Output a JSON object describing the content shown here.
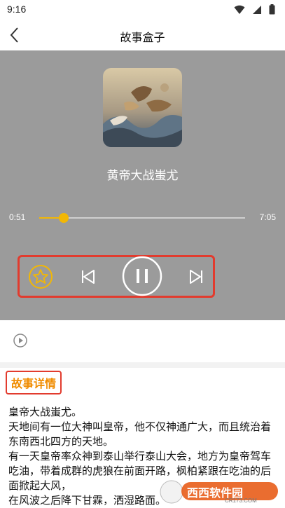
{
  "status": {
    "time": "9:16"
  },
  "header": {
    "title": "故事盒子"
  },
  "player": {
    "song_title": "黄帝大战蚩尤",
    "time_current": "0:51",
    "time_total": "7:05",
    "progress": 0.12
  },
  "detail": {
    "heading": "故事详情",
    "lines": [
      "皇帝大战蚩尤。",
      "天地间有一位大神叫皇帝，他不仅神通广大，而且统治着东南西北四方的天地。",
      "有一天皇帝率众神到泰山举行泰山大会，地方为皇帝驾车吃油，带着成群的虎狼在前面开路，枫柏紧跟在吃油的后面掀起大风，",
      "在风波之后降下甘霖，洒湿路面。"
    ]
  },
  "watermark": {
    "text": "西西软件园",
    "sub": "CR173.COM"
  },
  "colors": {
    "accent": "#f2b705",
    "highlight": "#e23b2e",
    "tag_text": "#f08c00"
  }
}
